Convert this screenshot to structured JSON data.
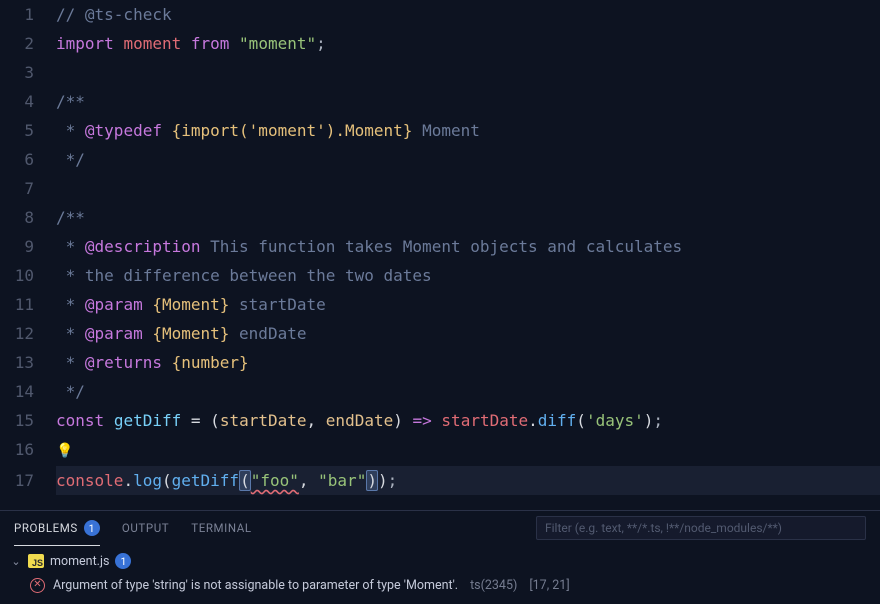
{
  "code": {
    "lines": [
      {
        "n": 1,
        "tokens": [
          [
            "c-comment",
            "// @ts-check"
          ]
        ]
      },
      {
        "n": 2,
        "tokens": [
          [
            "c-key",
            "import"
          ],
          [
            "c-plain",
            " "
          ],
          [
            "c-ident",
            "moment"
          ],
          [
            "c-plain",
            " "
          ],
          [
            "c-key",
            "from"
          ],
          [
            "c-plain",
            " "
          ],
          [
            "c-string",
            "\"moment\""
          ],
          [
            "c-plain",
            ";"
          ]
        ]
      },
      {
        "n": 3,
        "tokens": []
      },
      {
        "n": 4,
        "tokens": [
          [
            "c-comment",
            "/**"
          ]
        ]
      },
      {
        "n": 5,
        "tokens": [
          [
            "c-comment",
            " * "
          ],
          [
            "c-tag",
            "@typedef"
          ],
          [
            "c-comment",
            " "
          ],
          [
            "c-doctype",
            "{import('moment').Moment}"
          ],
          [
            "c-comment",
            " Moment"
          ]
        ]
      },
      {
        "n": 6,
        "tokens": [
          [
            "c-comment",
            " */"
          ]
        ]
      },
      {
        "n": 7,
        "tokens": []
      },
      {
        "n": 8,
        "tokens": [
          [
            "c-comment",
            "/**"
          ]
        ]
      },
      {
        "n": 9,
        "tokens": [
          [
            "c-comment",
            " * "
          ],
          [
            "c-tag",
            "@description"
          ],
          [
            "c-comment",
            " This function takes Moment objects and calculates"
          ]
        ]
      },
      {
        "n": 10,
        "tokens": [
          [
            "c-comment",
            " * the difference between the two dates"
          ]
        ]
      },
      {
        "n": 11,
        "tokens": [
          [
            "c-comment",
            " * "
          ],
          [
            "c-tag",
            "@param"
          ],
          [
            "c-comment",
            " "
          ],
          [
            "c-doctype",
            "{Moment}"
          ],
          [
            "c-comment",
            " startDate"
          ]
        ]
      },
      {
        "n": 12,
        "tokens": [
          [
            "c-comment",
            " * "
          ],
          [
            "c-tag",
            "@param"
          ],
          [
            "c-comment",
            " "
          ],
          [
            "c-doctype",
            "{Moment}"
          ],
          [
            "c-comment",
            " endDate"
          ]
        ]
      },
      {
        "n": 13,
        "tokens": [
          [
            "c-comment",
            " * "
          ],
          [
            "c-tag",
            "@returns"
          ],
          [
            "c-comment",
            " "
          ],
          [
            "c-doctype",
            "{number}"
          ]
        ]
      },
      {
        "n": 14,
        "tokens": [
          [
            "c-comment",
            " */"
          ]
        ]
      },
      {
        "n": 15,
        "tokens": [
          [
            "c-key",
            "const"
          ],
          [
            "c-plain",
            " "
          ],
          [
            "c-funcdef",
            "getDiff"
          ],
          [
            "c-plain",
            " "
          ],
          [
            "c-white",
            "="
          ],
          [
            "c-plain",
            " "
          ],
          [
            "c-white",
            "("
          ],
          [
            "c-param",
            "startDate"
          ],
          [
            "c-white",
            ","
          ],
          [
            "c-plain",
            " "
          ],
          [
            "c-param",
            "endDate"
          ],
          [
            "c-white",
            ")"
          ],
          [
            "c-plain",
            " "
          ],
          [
            "c-key",
            "=>"
          ],
          [
            "c-plain",
            " "
          ],
          [
            "c-ident",
            "startDate"
          ],
          [
            "c-white",
            "."
          ],
          [
            "c-func",
            "diff"
          ],
          [
            "c-white",
            "("
          ],
          [
            "c-string",
            "'days'"
          ],
          [
            "c-white",
            ")"
          ],
          [
            "c-plain",
            ";"
          ]
        ]
      },
      {
        "n": 16,
        "tokens": [],
        "bulb": true
      },
      {
        "n": 17,
        "current": true,
        "tokens": [
          [
            "c-ident",
            "console"
          ],
          [
            "c-white",
            "."
          ],
          [
            "c-func",
            "log"
          ],
          [
            "c-white",
            "("
          ],
          [
            "c-func",
            "getDiff"
          ],
          [
            "c-white bracket-hl",
            "("
          ],
          [
            "c-string squiggle",
            "\"foo\""
          ],
          [
            "c-white",
            ","
          ],
          [
            "c-plain",
            " "
          ],
          [
            "c-string",
            "\"bar\""
          ],
          [
            "c-white bracket-hl",
            ")"
          ],
          [
            "c-white",
            ")"
          ],
          [
            "c-plain",
            ";"
          ]
        ]
      }
    ]
  },
  "panel": {
    "tabs": {
      "problems": {
        "label": "PROBLEMS",
        "count": "1"
      },
      "output": {
        "label": "OUTPUT"
      },
      "terminal": {
        "label": "TERMINAL"
      }
    },
    "filter_placeholder": "Filter (e.g. text, **/*.ts, !**/node_modules/**)",
    "file": {
      "name": "moment.js",
      "count": "1"
    },
    "error": {
      "message": "Argument of type 'string' is not assignable to parameter of type 'Moment'.",
      "code": "ts(2345)",
      "loc": "[17, 21]"
    }
  }
}
